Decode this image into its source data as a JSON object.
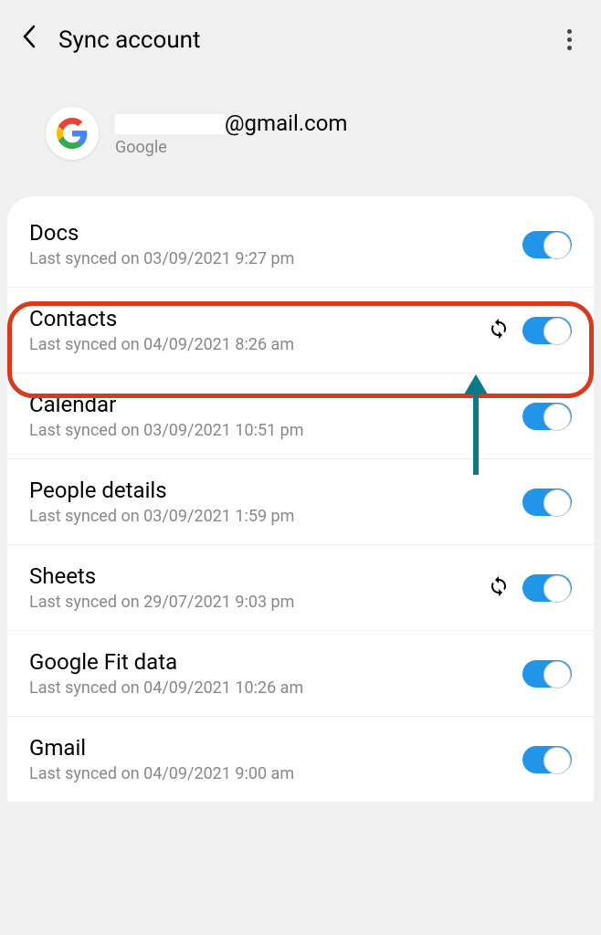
{
  "header": {
    "title": "Sync account"
  },
  "account": {
    "email_suffix": "@gmail.com",
    "provider": "Google"
  },
  "rows": [
    {
      "title": "Docs",
      "sub": "Last synced on 03/09/2021  9:27 pm",
      "syncing": false
    },
    {
      "title": "Contacts",
      "sub": "Last synced on 04/09/2021  8:26 am",
      "syncing": true
    },
    {
      "title": "Calendar",
      "sub": "Last synced on 03/09/2021  10:51 pm",
      "syncing": false
    },
    {
      "title": "People details",
      "sub": "Last synced on 03/09/2021  1:59 pm",
      "syncing": false
    },
    {
      "title": "Sheets",
      "sub": "Last synced on 29/07/2021  9:03 pm",
      "syncing": true
    },
    {
      "title": "Google Fit data",
      "sub": "Last synced on 04/09/2021  10:26 am",
      "syncing": false
    },
    {
      "title": "Gmail",
      "sub": "Last synced on 04/09/2021  9:00 am",
      "syncing": false
    }
  ]
}
